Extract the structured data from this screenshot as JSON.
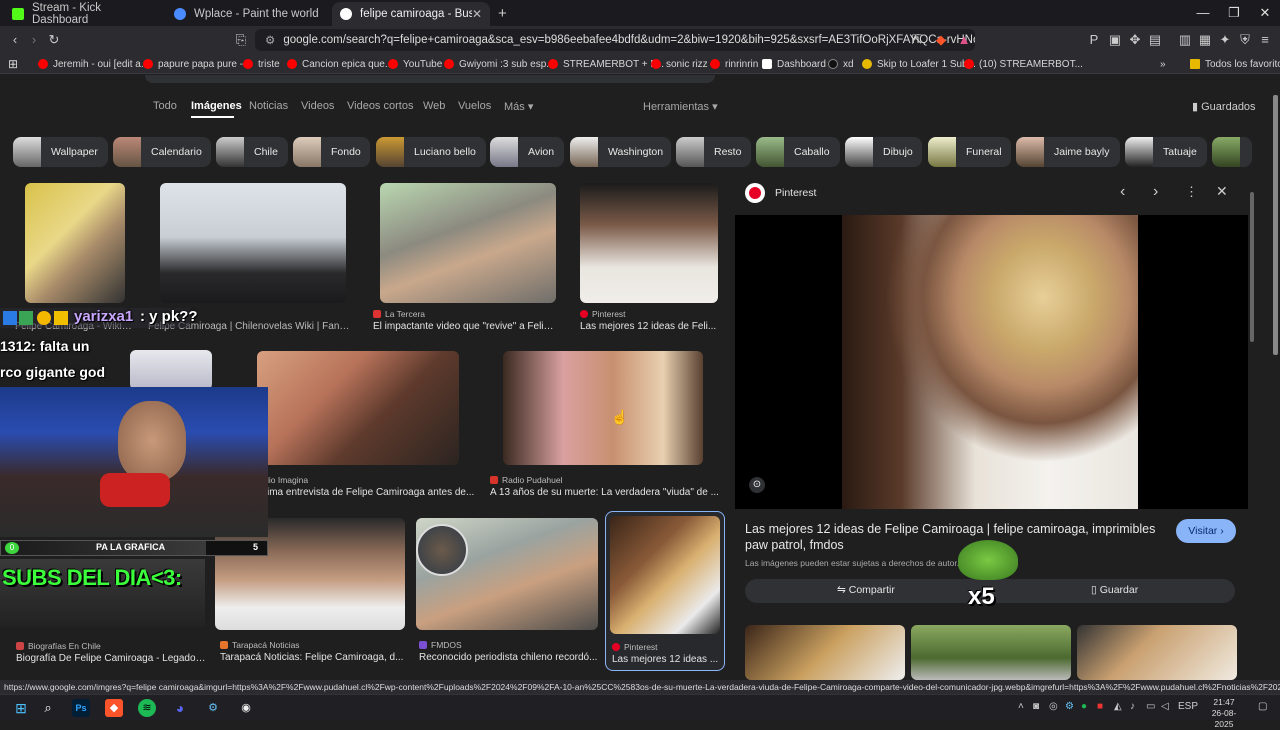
{
  "tabs": [
    {
      "title": "Stream - Kick Dashboard",
      "fav": "#53fc18"
    },
    {
      "title": "Wplace - Paint the world",
      "fav": "#4a8cff"
    },
    {
      "title": "felipe camiroaga - Buscar con Go",
      "fav": "#ffffff"
    }
  ],
  "toolbar": {
    "url": "google.com/search?q=felipe+camiroaga&sca_esv=b986eebafee4bdfd&udm=2&biw=1920&bih=925&sxsrf=AE3TifOoRjXFAYiQCa-rvHNoGIRz3SGqR..."
  },
  "bookmarks": [
    {
      "label": "Jeremih - oui [edit a...",
      "color": "#ff0000"
    },
    {
      "label": "papure papa pure -...",
      "color": "#ff0000"
    },
    {
      "label": "triste",
      "color": "#ff0000"
    },
    {
      "label": "Cancion epica que...",
      "color": "#ff0000"
    },
    {
      "label": "YouTube",
      "color": "#ff0000"
    },
    {
      "label": "Gwiyomi :3 sub esp...",
      "color": "#ff0000"
    },
    {
      "label": "STREAMERBOT + P...",
      "color": "#ff0000"
    },
    {
      "label": "sonic rizz",
      "color": "#ff0000"
    },
    {
      "label": "rinrinrin",
      "color": "#ff0000"
    },
    {
      "label": "Dashboard",
      "color": "#ffffff"
    },
    {
      "label": "xd",
      "color": "#000000"
    },
    {
      "label": "Skip to Loafer 1 Sub...",
      "color": "#e6b800"
    },
    {
      "label": "(10) STREAMERBOT...",
      "color": "#ff0000"
    },
    {
      "label": "Todos los favoritos",
      "color": "#e6b800"
    }
  ],
  "search_nav": {
    "items": [
      "Todo",
      "Imágenes",
      "Noticias",
      "Videos",
      "Videos cortos",
      "Web",
      "Vuelos",
      "Más"
    ],
    "tools": "Herramientas",
    "saved": "Guardados"
  },
  "chips": [
    "Wallpaper",
    "Calendario",
    "Chile",
    "Fondo",
    "Luciano bello",
    "Avion",
    "Washington",
    "Resto",
    "Caballo",
    "Dibujo",
    "Funeral",
    "Jaime bayly",
    "Tatuaje"
  ],
  "results": [
    {
      "source": "",
      "caption": "Felipe Camiroaga - Wikip..."
    },
    {
      "source": "",
      "caption": "Felipe Camiroaga | Chilenovelas Wiki | Fand..."
    },
    {
      "source": "La Tercera",
      "caption": "El impactante video que \"revive\" a Felipe ..."
    },
    {
      "source": "Pinterest",
      "caption": "Las mejores 12 ideas de Feli..."
    },
    {
      "source": "",
      "caption": ""
    },
    {
      "source": "lio Imagina",
      "caption": "ima entrevista de Felipe Camiroaga antes de..."
    },
    {
      "source": "Radio Pudahuel",
      "caption": "A 13 años de su muerte: La verdadera \"viuda\" de ..."
    },
    {
      "source": "Biografías En Chile",
      "caption": "Biografía De Felipe Camiroaga - Legado ..."
    },
    {
      "source": "Tarapacá Noticias",
      "caption": "Tarapacá Noticias: Felipe Camiroaga, d..."
    },
    {
      "source": "FMDOS",
      "caption": "Reconocido periodista chileno recordó..."
    },
    {
      "source": "Pinterest",
      "caption": "Las mejores 12 ideas ..."
    }
  ],
  "panel": {
    "source": "Pinterest",
    "title": "Las mejores 12 ideas de Felipe Camiroaga | felipe camiroaga, imprimibles paw patrol, fmdos",
    "visit": "Visitar",
    "notice": "Las imágenes pueden estar sujetas a derechos de autor.",
    "more": "Má",
    "share": "Compartir",
    "save": "Guardar"
  },
  "overlay": {
    "chat_user": "yarizxa1",
    "chat_msg": ": y pk??",
    "chat2_user": "1312",
    "chat2_msg": ": falta un",
    "chat2_line2": "rco gigante god",
    "goal_label": "PA LA GRAFICA",
    "goal_count": "5",
    "goal_badge": "0",
    "subs": "SUBS DEL DIA<3:",
    "multiplier": "x5"
  },
  "status_url": "https://www.google.com/imgres?q=felipe camiroaga&imgurl=https%3A%2F%2Fwww.pudahuel.cl%2Fwp-content%2Fuploads%2F2024%2F09%2FA-10-an%25CC%2583os-de-su-muerte-La-verdadera-viuda-de-Felipe-Camiroaga-comparte-video-del-comunicador-jpg.webp&imgrefurl=https%3A%2F%2Fwww.pudahuel.cl%2Fnoticias%2F2024%2F09%2Fa-...",
  "taskbar": {
    "lang": "ESP",
    "time": "21:47",
    "date": "26-08-2025"
  }
}
